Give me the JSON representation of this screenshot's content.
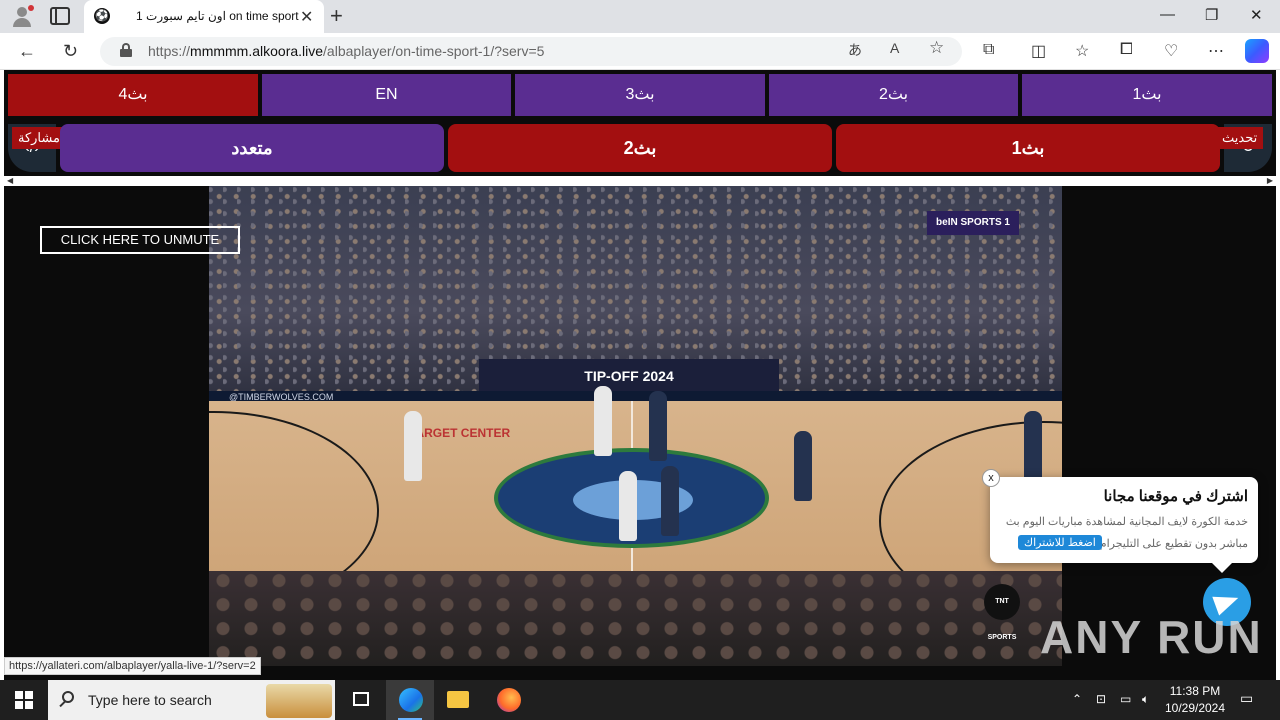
{
  "browser": {
    "tab_title": "اون تايم سبورت 1 on time sport",
    "favicon": "⚽",
    "url_prefix": "https://",
    "url_host": "mmmmm.alkoora.live",
    "url_path": "/albaplayer/on-time-sport-1/?serv=5",
    "status_url": "https://yallateri.com/albaplayer/yalla-live-1/?serv=2"
  },
  "servers_row1": [
    {
      "label": "بث4",
      "color": "red"
    },
    {
      "label": "EN",
      "color": "purple"
    },
    {
      "label": "بث3",
      "color": "purple"
    },
    {
      "label": "بث2",
      "color": "purple"
    },
    {
      "label": "بث1",
      "color": "purple"
    }
  ],
  "servers_row2": [
    {
      "label": "متعدد",
      "color": "purple"
    },
    {
      "label": "بث2",
      "color": "red"
    },
    {
      "label": "بث1",
      "color": "red"
    }
  ],
  "share_label": "مشاركة",
  "refresh_label": "تحديث",
  "video": {
    "unmute_label": "CLICK HERE TO UNMUTE",
    "channel_logo": "beIN SPORTS 1",
    "banner": "TIP-OFF 2024",
    "wall_text": "@TIMBERWOLVES.COM",
    "court_text": "TARGET CENTER",
    "tnt_logo": "TNT SPORTS"
  },
  "popup": {
    "title": "اشترك في موقعنا مجانا",
    "description": "خدمة الكورة لايف المجانية لمشاهدة مباريات اليوم بث مباشر بدون تقطيع على التليجرام",
    "cta": "اضغط للاشتراك",
    "close": "x"
  },
  "watermark": "ANY RUN",
  "taskbar": {
    "search_placeholder": "Type here to search",
    "time": "11:38 PM",
    "date": "10/29/2024"
  },
  "colors": {
    "purple": "#5a2d91",
    "red": "#a30f10",
    "telegram": "#2a9ee5"
  }
}
